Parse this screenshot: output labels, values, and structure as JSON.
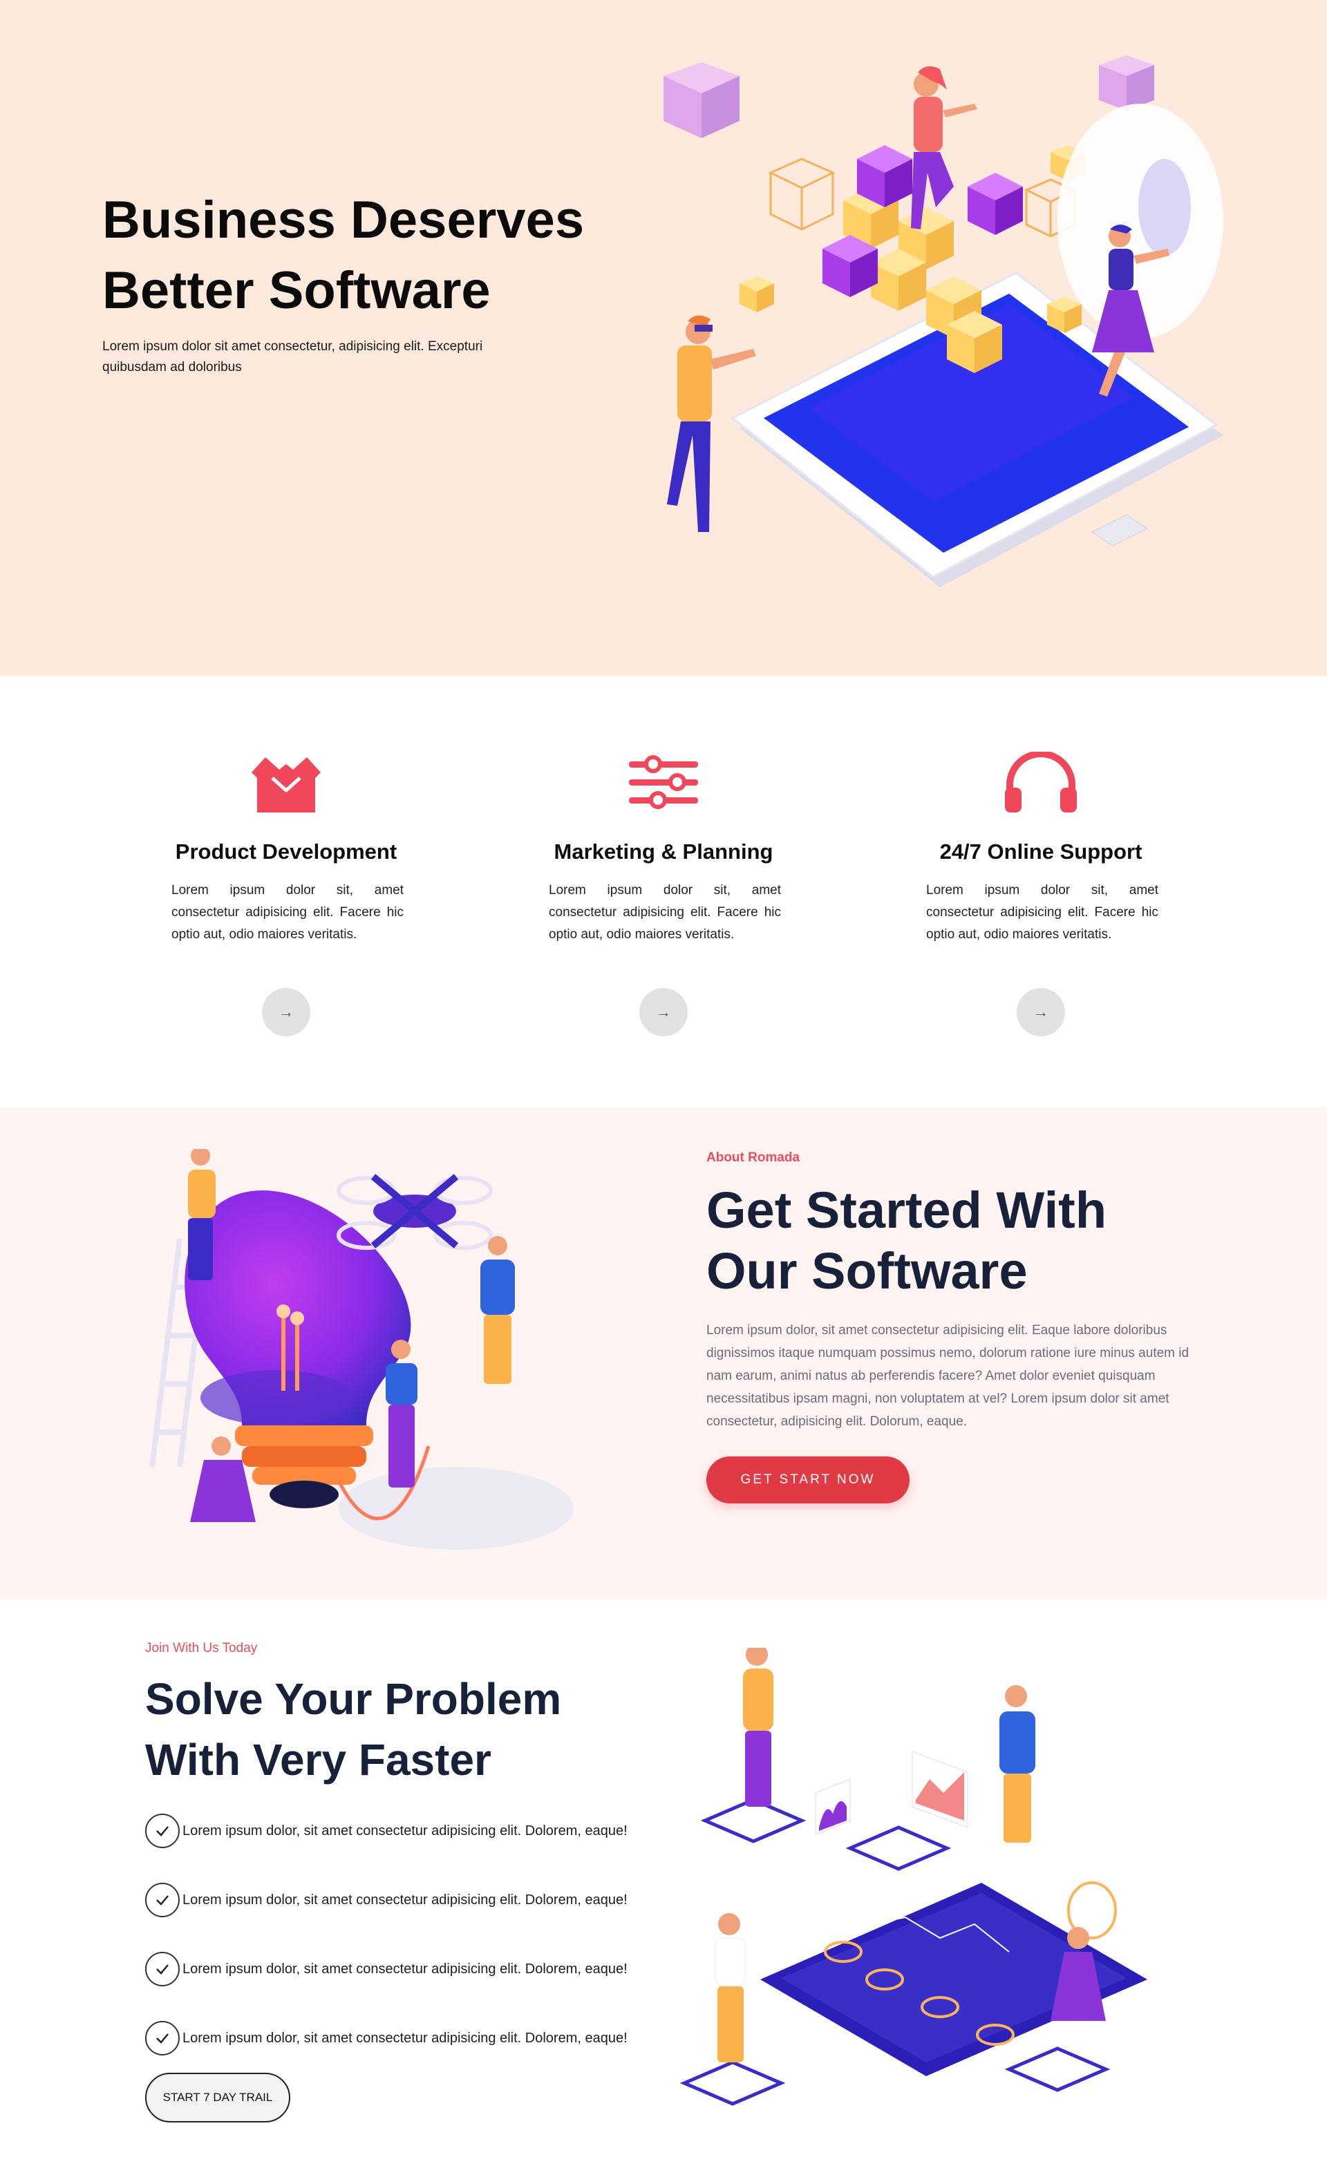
{
  "hero": {
    "title_line1": "Business Deserves",
    "title_line2": "Better Software",
    "subtitle": "Lorem ipsum dolor sit amet consectetur, adipisicing elit. Excepturi quibusdam ad doloribus"
  },
  "features": [
    {
      "icon": "box-icon",
      "title": "Product Development",
      "text": "Lorem ipsum dolor sit, amet consectetur adipisicing elit. Facere hic optio aut, odio maiores veritatis.",
      "arrow": "→"
    },
    {
      "icon": "sliders-icon",
      "title": "Marketing & Planning",
      "text": "Lorem ipsum dolor sit, amet consectetur adipisicing elit. Facere hic optio aut, odio maiores veritatis.",
      "arrow": "→"
    },
    {
      "icon": "headphones-icon",
      "title": "24/7 Online Support",
      "text": "Lorem ipsum dolor sit, amet consectetur adipisicing elit. Facere hic optio aut, odio maiores veritatis.",
      "arrow": "→"
    }
  ],
  "about": {
    "eyebrow": "About Romada",
    "title_line1": "Get Started With",
    "title_line2": "Our Software",
    "body": "Lorem ipsum dolor, sit amet consectetur adipisicing elit. Eaque labore doloribus dignissimos itaque numquam possimus nemo, dolorum ratione iure minus autem id nam earum, animi natus ab perferendis facere? Amet dolor eveniet quisquam necessitatibus ipsam magni, non voluptatem at vel? Lorem ipsum dolor sit amet consectetur, adipisicing elit. Dolorum, eaque.",
    "cta": "GET START NOW"
  },
  "solve": {
    "eyebrow": "Join With Us Today",
    "title_line1": "Solve Your Problem",
    "title_line2": "With Very Faster",
    "checks": [
      "Lorem ipsum dolor, sit amet consectetur adipisicing elit. Dolorem, eaque!",
      "Lorem ipsum dolor, sit amet consectetur adipisicing elit. Dolorem, eaque!",
      "Lorem ipsum dolor, sit amet consectetur adipisicing elit. Dolorem, eaque!",
      "Lorem ipsum dolor, sit amet consectetur adipisicing elit. Dolorem, eaque!"
    ],
    "button": "START 7 DAY TRAIL"
  },
  "colors": {
    "hero_bg": "#feeadc",
    "accent_red": "#e94e5c",
    "cta_red": "#e03a44",
    "about_bg": "#fff4f2",
    "heading_navy": "#18213a"
  }
}
